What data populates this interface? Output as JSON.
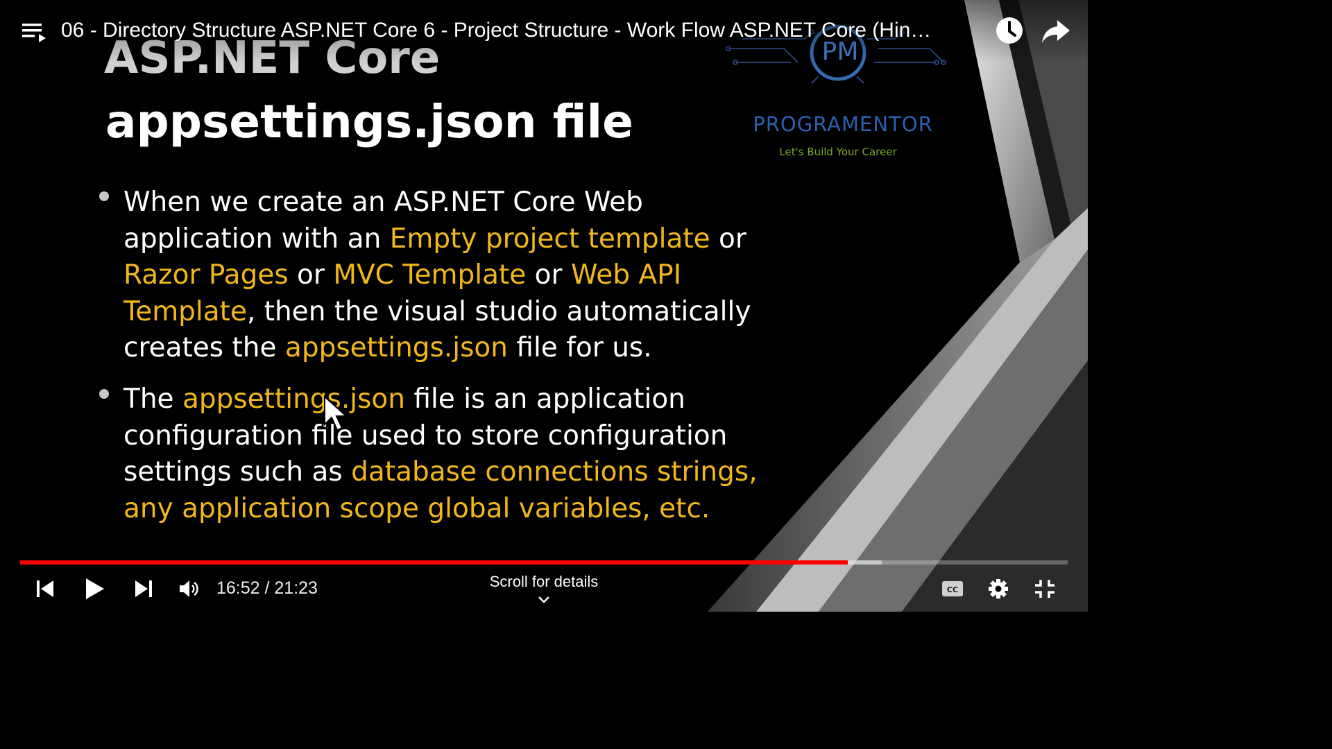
{
  "player": {
    "title": "06 - Directory Structure ASP.NET Core 6 - Project Structure - Work Flow ASP.NET Core (Hin…",
    "time_display": "16:52 / 21:23",
    "scroll_hint": "Scroll for details",
    "progress": {
      "played_fraction": 0.7898,
      "buffered_fraction": 0.8225
    }
  },
  "slide": {
    "heading_1": "ASP.NET Core",
    "heading_2": "appsettings.json file",
    "logo": {
      "initials": "PM",
      "name": "PROGRAMENTOR",
      "tagline": "Let's Build Your Career"
    },
    "bullet_1": {
      "t1": "When we create an ASP.NET Core Web application with an ",
      "h1": "Empty project template",
      "t2": " or ",
      "h2": "Razor Pages",
      "t3": " or ",
      "h3": "MVC Template",
      "t4": " or ",
      "h4": "Web API Template",
      "t5": ", then the visual studio automatically creates the ",
      "h5": "appsettings.json",
      "t6": " file for us."
    },
    "bullet_2": {
      "t1": "The ",
      "h1": "appsettings.json",
      "t2": " file is an application configuration file used to store configuration settings such as ",
      "h2": "database connections strings, any application scope global variables, etc."
    }
  },
  "colors": {
    "highlight": "#f2b718",
    "progress_played": "#ff0000",
    "logo_blue": "#2d5fb0",
    "logo_tagline": "#7fa72a"
  },
  "icons": {
    "top": [
      "playlist-icon",
      "watch-later-icon",
      "share-icon"
    ],
    "bottom": [
      "previous-icon",
      "play-icon",
      "next-icon",
      "volume-icon",
      "captions-icon",
      "settings-icon",
      "exit-fullscreen-icon"
    ]
  }
}
